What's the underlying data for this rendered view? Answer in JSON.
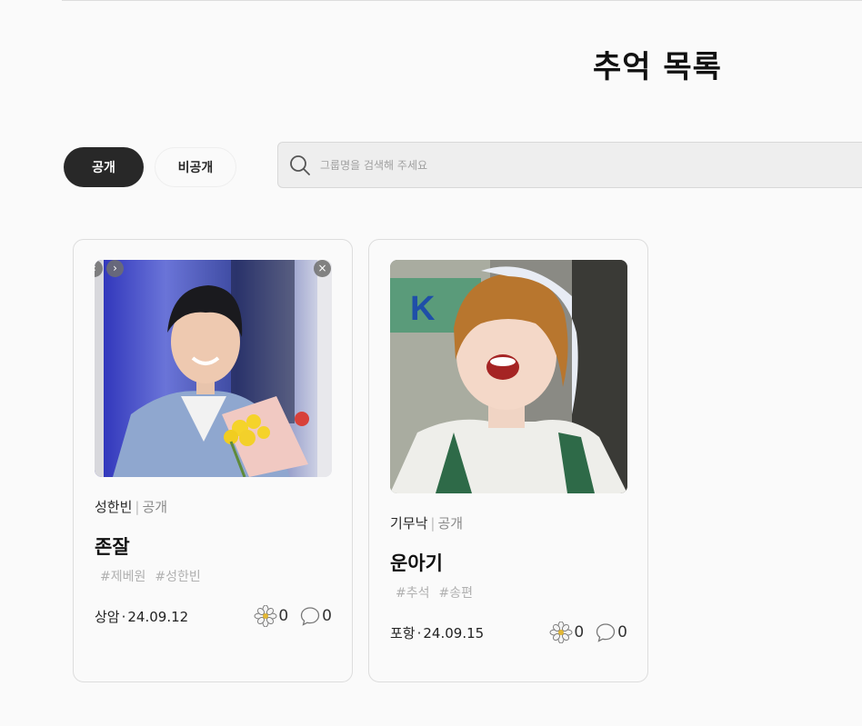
{
  "page": {
    "title": "추억 목록"
  },
  "filters": {
    "public_label": "공개",
    "private_label": "비공개",
    "active": "public"
  },
  "search": {
    "placeholder": "그룹명을 검색해 주세요",
    "value": ""
  },
  "cards": [
    {
      "author": "성한빈",
      "separator": "|",
      "visibility": "공개",
      "title": "존잘",
      "tags": [
        "#제베원",
        "#성한빈"
      ],
      "location": "상암",
      "dot": "·",
      "date": "24.09.12",
      "likes": "0",
      "comments": "0",
      "carousel": {
        "prev": "‹",
        "next": "›",
        "close": "×"
      }
    },
    {
      "author": "기무낙",
      "separator": "|",
      "visibility": "공개",
      "title": "운아기",
      "tags": [
        "#추석",
        "#송편"
      ],
      "location": "포항",
      "dot": "·",
      "date": "24.09.15",
      "likes": "0",
      "comments": "0"
    }
  ],
  "icons": {
    "search": "search-icon",
    "like": "flower-icon",
    "comment": "speech-bubble-icon"
  },
  "colors": {
    "background": "#fafafa",
    "active_toggle": "#282828",
    "search_bg": "#eeeeee",
    "tag_text": "#b0b0b0",
    "card_border": "#dddddd"
  }
}
